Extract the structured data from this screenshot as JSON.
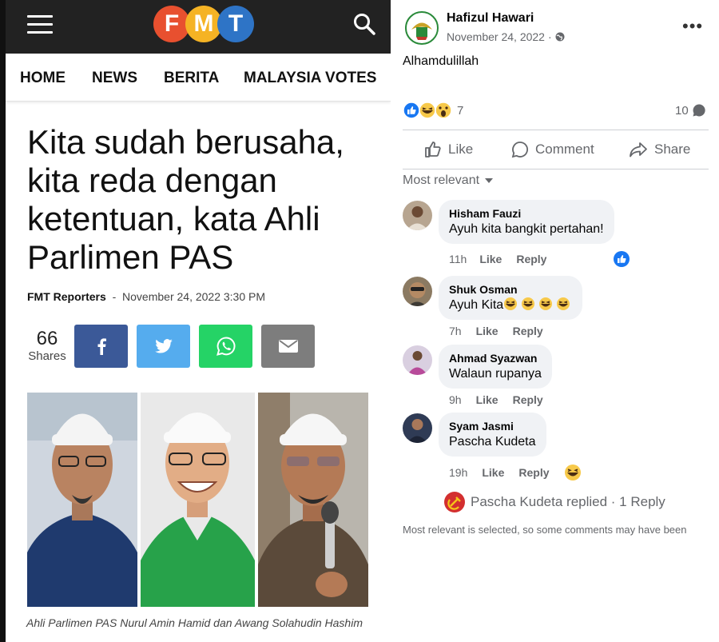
{
  "article": {
    "site_logo_letters": [
      "F",
      "M",
      "T"
    ],
    "logo_colors": [
      "#e8502f",
      "#f5b324",
      "#2e74c6"
    ],
    "nav": [
      "HOME",
      "NEWS",
      "BERITA",
      "MALAYSIA VOTES"
    ],
    "headline": "Kita sudah berusaha, kita reda dengan ketentuan, kata Ahli Parlimen PAS",
    "author": "FMT Reporters",
    "separator": "-",
    "date": "November 24, 2022 3:30 PM",
    "shares_count": "66",
    "shares_label": "Shares",
    "share_buttons": [
      {
        "icon": "facebook-icon",
        "color": "#3b5998"
      },
      {
        "icon": "twitter-icon",
        "color": "#55acee"
      },
      {
        "icon": "whatsapp-icon",
        "color": "#25d366"
      },
      {
        "icon": "email-icon",
        "color": "#7d7d7d"
      }
    ],
    "caption": "Ahli Parlimen PAS Nurul Amin Hamid dan Awang Solahudin Hashim"
  },
  "post": {
    "author": "Hafizul Hawari",
    "date": "November 24, 2022",
    "date_separator": "·",
    "text": "Alhamdulillah",
    "reaction_count": "7",
    "comment_count": "10",
    "actions": {
      "like": "Like",
      "comment": "Comment",
      "share": "Share"
    },
    "sort_label": "Most relevant",
    "comments": [
      {
        "name": "Hisham Fauzi",
        "text": "Ayuh kita bangkit pertahan!",
        "time": "11h",
        "like": "Like",
        "reply": "Reply",
        "avatar_color": "#b7a590"
      },
      {
        "name": "Shuk Osman",
        "text": "Ayuh Kita",
        "time": "7h",
        "like": "Like",
        "reply": "Reply",
        "avatar_color": "#8b7a62"
      },
      {
        "name": "Ahmad Syazwan",
        "text": "Walaun rupanya",
        "time": "9h",
        "like": "Like",
        "reply": "Reply",
        "avatar_color": "#c2a8c6"
      },
      {
        "name": "Syam Jasmi",
        "text": "Pascha Kudeta",
        "time": "19h",
        "like": "Like",
        "reply": "Reply",
        "avatar_color": "#2f3b55"
      }
    ],
    "replied_text": "Pascha Kudeta replied · 1 Reply",
    "footer_note": "Most relevant is selected, so some comments may have been"
  }
}
